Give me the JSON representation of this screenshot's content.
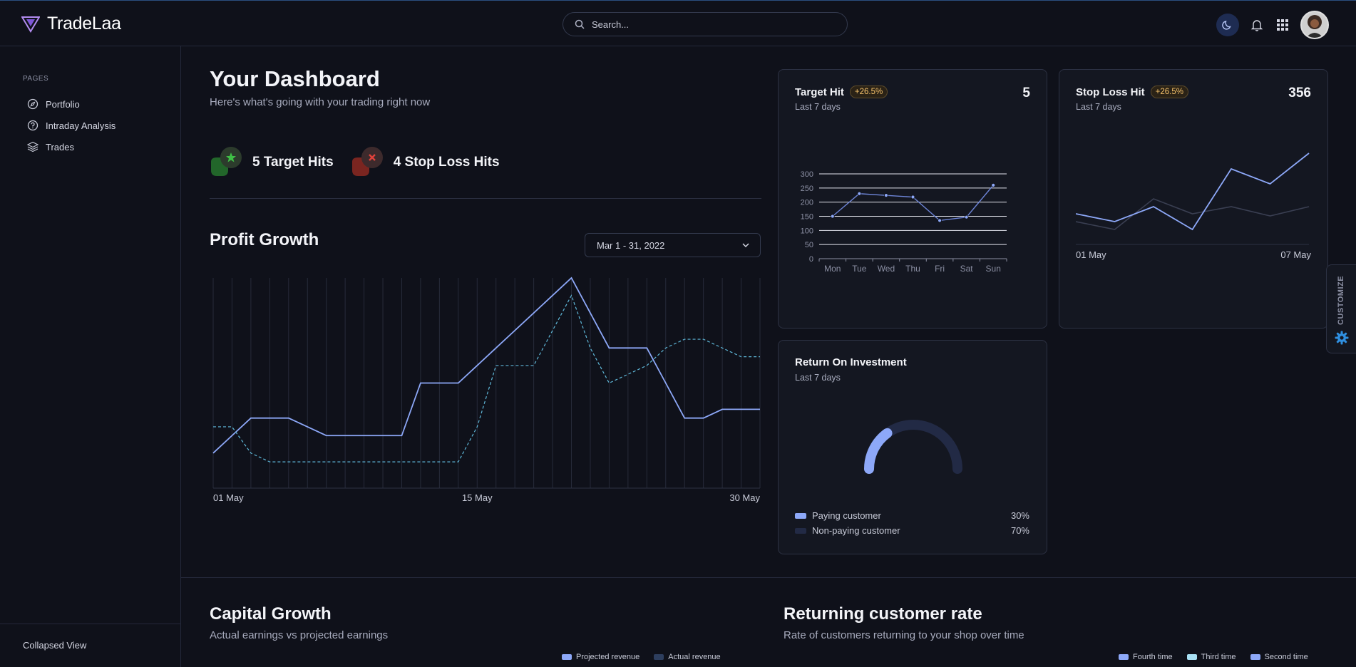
{
  "app": {
    "name": "TradeLaa"
  },
  "search": {
    "placeholder": "Search..."
  },
  "sidebar": {
    "section": "PAGES",
    "items": [
      {
        "label": "Portfolio",
        "icon": "compass-icon"
      },
      {
        "label": "Intraday Analysis",
        "icon": "help-circle-icon"
      },
      {
        "label": "Trades",
        "icon": "layers-icon"
      }
    ],
    "footer": "Collapsed View"
  },
  "dashboard": {
    "title": "Your Dashboard",
    "subtitle": "Here's what's going with your trading right now",
    "target_hits": "5 Target Hits",
    "stop_loss_hits": "4 Stop Loss Hits"
  },
  "profit_growth": {
    "title": "Profit Growth",
    "date_range": "Mar 1 - 31, 2022",
    "x_labels": [
      "01 May",
      "15 May",
      "30 May"
    ]
  },
  "target_hit_card": {
    "title": "Target Hit",
    "change": "+26.5%",
    "period": "Last 7 days",
    "value": "5"
  },
  "stop_loss_card": {
    "title": "Stop Loss Hit",
    "change": "+26.5%",
    "period": "Last 7 days",
    "value": "356",
    "x_start": "01 May",
    "x_end": "07 May"
  },
  "roi_card": {
    "title": "Return On Investment",
    "period": "Last 7 days",
    "legend": [
      {
        "label": "Paying customer",
        "value": "30%",
        "color": "#8da8f8"
      },
      {
        "label": "Non-paying customer",
        "value": "70%",
        "color": "#222a45"
      }
    ]
  },
  "capital_growth": {
    "title": "Capital Growth",
    "subtitle": "Actual earnings vs projected earnings",
    "legend": [
      {
        "label": "Projected revenue",
        "color": "#8da8f8"
      },
      {
        "label": "Actual revenue",
        "color": "#2d3e5e"
      }
    ]
  },
  "returning_rate": {
    "title": "Returning customer rate",
    "subtitle": "Rate of customers returning to your shop over time",
    "legend": [
      {
        "label": "Fourth time",
        "color": "#8da8f8"
      },
      {
        "label": "Third time",
        "color": "#a8e0f4"
      },
      {
        "label": "Second time",
        "color": "#8da8f8"
      }
    ]
  },
  "customize": {
    "label": "CUSTOMIZE"
  },
  "colors": {
    "accent": "#8da8f8",
    "dashed": "#5fb8d9",
    "badge_green": "#3fbf46",
    "badge_red": "#e0423c",
    "pill": "#f6c26b"
  },
  "chart_data": [
    {
      "type": "line",
      "name": "Profit Growth",
      "title": "Profit Growth",
      "x_ticks": [
        "01 May",
        "15 May",
        "30 May"
      ],
      "x": [
        1,
        2,
        3,
        4,
        5,
        6,
        7,
        8,
        9,
        10,
        11,
        12,
        13,
        14,
        15,
        16,
        17,
        18,
        19,
        20,
        21,
        22,
        23,
        24,
        25,
        26,
        27,
        28,
        29,
        30
      ],
      "series": [
        {
          "style": "solid",
          "values": [
            2,
            3,
            4,
            4,
            4,
            3.5,
            3,
            3,
            3,
            3,
            3,
            6,
            6,
            6,
            7,
            8,
            9,
            10,
            11,
            12,
            10,
            8,
            8,
            8,
            6,
            4,
            4,
            4.5,
            4.5,
            4.5
          ]
        },
        {
          "style": "dashed",
          "values": [
            3.5,
            3.5,
            2,
            1.5,
            1.5,
            1.5,
            1.5,
            1.5,
            1.5,
            1.5,
            1.5,
            1.5,
            1.5,
            1.5,
            3.5,
            7,
            7,
            7,
            9,
            11,
            8,
            6,
            6.5,
            7,
            8,
            8.5,
            8.5,
            8,
            7.5,
            7.5
          ]
        }
      ]
    },
    {
      "type": "line",
      "name": "Target Hit",
      "categories": [
        "Mon",
        "Tue",
        "Wed",
        "Thu",
        "Fri",
        "Sat",
        "Sun"
      ],
      "values": [
        150,
        230,
        224,
        218,
        135,
        147,
        260
      ],
      "yticks": [
        0,
        50,
        100,
        150,
        200,
        250,
        300
      ],
      "ylim": [
        0,
        300
      ]
    },
    {
      "type": "line",
      "name": "Stop Loss Hit",
      "x_ticks": [
        "01 May",
        "07 May"
      ],
      "series": [
        {
          "values": [
            43,
            32,
            53,
            21,
            106,
            85,
            128
          ],
          "color": "#8da8f8"
        },
        {
          "values": [
            32,
            21,
            64,
            43,
            53,
            40,
            53
          ],
          "color": "#3a3f52"
        }
      ]
    },
    {
      "type": "pie",
      "name": "Return On Investment",
      "categories": [
        "Paying customer",
        "Non-paying customer"
      ],
      "values": [
        30,
        70
      ]
    }
  ]
}
